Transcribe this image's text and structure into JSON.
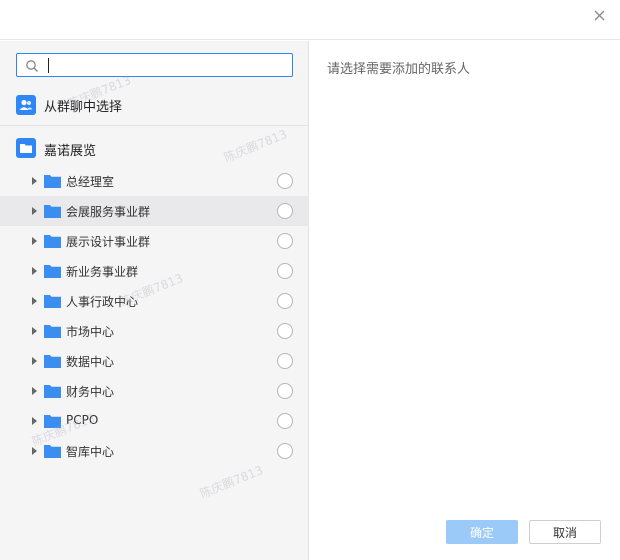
{
  "window": {
    "close_label": "×"
  },
  "search": {
    "placeholder": "",
    "value": ""
  },
  "group_select": {
    "label": "从群聊中选择"
  },
  "org": {
    "root_label": "嘉诺展览",
    "departments": [
      {
        "label": "总经理室"
      },
      {
        "label": "会展服务事业群"
      },
      {
        "label": "展示设计事业群"
      },
      {
        "label": "新业务事业群"
      },
      {
        "label": "人事行政中心"
      },
      {
        "label": "市场中心"
      },
      {
        "label": "数据中心"
      },
      {
        "label": "财务中心"
      },
      {
        "label": "PCPO"
      },
      {
        "label": "智库中心"
      }
    ]
  },
  "selected_panel": {
    "hint": "请选择需要添加的联系人"
  },
  "buttons": {
    "ok_label": "确定",
    "cancel_label": "取消"
  },
  "watermark": {
    "text": "陈庆鹏7813"
  },
  "colors": {
    "accent": "#2f86f5",
    "ok_disabled": "#9ccaf8",
    "hover_row": "#e9e9ec"
  }
}
